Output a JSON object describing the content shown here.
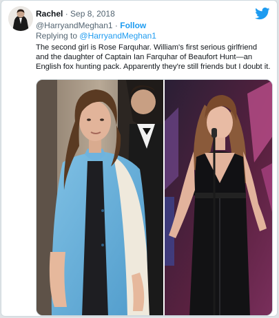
{
  "tweet": {
    "author_name": "Rachel",
    "separator": "·",
    "date": "Sep 8, 2018",
    "handle": "@HarryandMeghan1",
    "handle_separator": "·",
    "follow_label": "Follow",
    "replying_prefix": "Replying to",
    "replying_to": "@HarryandMeghan1",
    "text": "The second girl is Rose Farquhar. William's first serious girlfriend and the daughter of Captain Ian Farquhar of Beaufort Hunt—an English fox hunting pack. Apparently they're still friends but I doubt it."
  },
  "icons": {
    "brand": "twitter-bird-icon",
    "avatar": "profile-avatar"
  },
  "colors": {
    "accent": "#1d9bf0",
    "text": "#0f1419",
    "muted": "#536471",
    "border": "#cfd9de"
  }
}
